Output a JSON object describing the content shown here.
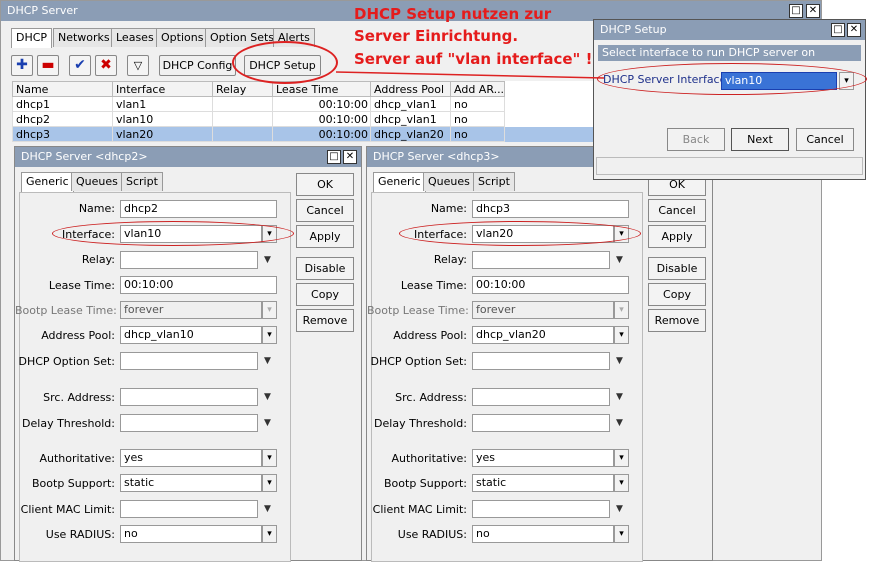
{
  "main_window": {
    "title": "DHCP Server",
    "tabs": [
      "DHCP",
      "Networks",
      "Leases",
      "Options",
      "Option Sets",
      "Alerts"
    ],
    "toolbar": {
      "dhcp_config": "DHCP Config",
      "dhcp_setup": "DHCP Setup"
    },
    "table": {
      "headers": [
        "Name",
        "Interface",
        "Relay",
        "Lease Time",
        "Address Pool",
        "Add AR..."
      ],
      "rows": [
        [
          "dhcp1",
          "vlan1",
          "",
          "00:10:00",
          "dhcp_vlan1",
          "no"
        ],
        [
          "dhcp2",
          "vlan10",
          "",
          "00:10:00",
          "dhcp_vlan1",
          "no"
        ],
        [
          "dhcp3",
          "vlan20",
          "",
          "00:10:00",
          "dhcp_vlan20",
          "no"
        ]
      ]
    }
  },
  "annotation": {
    "line1": "DHCP Setup nutzen zur",
    "line2": "Server Einrichtung.",
    "line3": "Server auf \"vlan interface\" !"
  },
  "dialogs": [
    {
      "title": "DHCP Server <dhcp2>",
      "tabs": [
        "Generic",
        "Queues",
        "Script"
      ],
      "fields": {
        "name_label": "Name:",
        "name": "dhcp2",
        "interface_label": "Interface:",
        "interface": "vlan10",
        "relay_label": "Relay:",
        "relay": "",
        "lease_label": "Lease Time:",
        "lease": "00:10:00",
        "bootp_lease_label": "Bootp Lease Time:",
        "bootp_lease": "forever",
        "pool_label": "Address Pool:",
        "pool": "dhcp_vlan10",
        "option_set_label": "DHCP Option Set:",
        "src_label": "Src. Address:",
        "delay_label": "Delay Threshold:",
        "auth_label": "Authoritative:",
        "auth": "yes",
        "bootp_support_label": "Bootp Support:",
        "bootp_support": "static",
        "mac_limit_label": "Client MAC Limit:",
        "radius_label": "Use RADIUS:",
        "radius": "no"
      },
      "buttons": [
        "OK",
        "Cancel",
        "Apply",
        "Disable",
        "Copy",
        "Remove"
      ]
    },
    {
      "title": "DHCP Server <dhcp3>",
      "tabs": [
        "Generic",
        "Queues",
        "Script"
      ],
      "fields": {
        "name_label": "Name:",
        "name": "dhcp3",
        "interface_label": "Interface:",
        "interface": "vlan20",
        "relay_label": "Relay:",
        "relay": "",
        "lease_label": "Lease Time:",
        "lease": "00:10:00",
        "bootp_lease_label": "Bootp Lease Time:",
        "bootp_lease": "forever",
        "pool_label": "Address Pool:",
        "pool": "dhcp_vlan20",
        "option_set_label": "DHCP Option Set:",
        "src_label": "Src. Address:",
        "delay_label": "Delay Threshold:",
        "auth_label": "Authoritative:",
        "auth": "yes",
        "bootp_support_label": "Bootp Support:",
        "bootp_support": "static",
        "mac_limit_label": "Client MAC Limit:",
        "radius_label": "Use RADIUS:",
        "radius": "no"
      },
      "buttons": [
        "OK",
        "Cancel",
        "Apply",
        "Disable",
        "Copy",
        "Remove"
      ]
    }
  ],
  "setup_dialog": {
    "title": "DHCP Setup",
    "hint": "Select interface to run DHCP server on",
    "label": "DHCP Server Interface:",
    "value": "vlan10",
    "back": "Back",
    "next": "Next",
    "cancel": "Cancel"
  },
  "colors": {
    "titlebar": "#8b9db5",
    "selected_row": "#a8c4e8",
    "annotation": "#e51b1b"
  }
}
